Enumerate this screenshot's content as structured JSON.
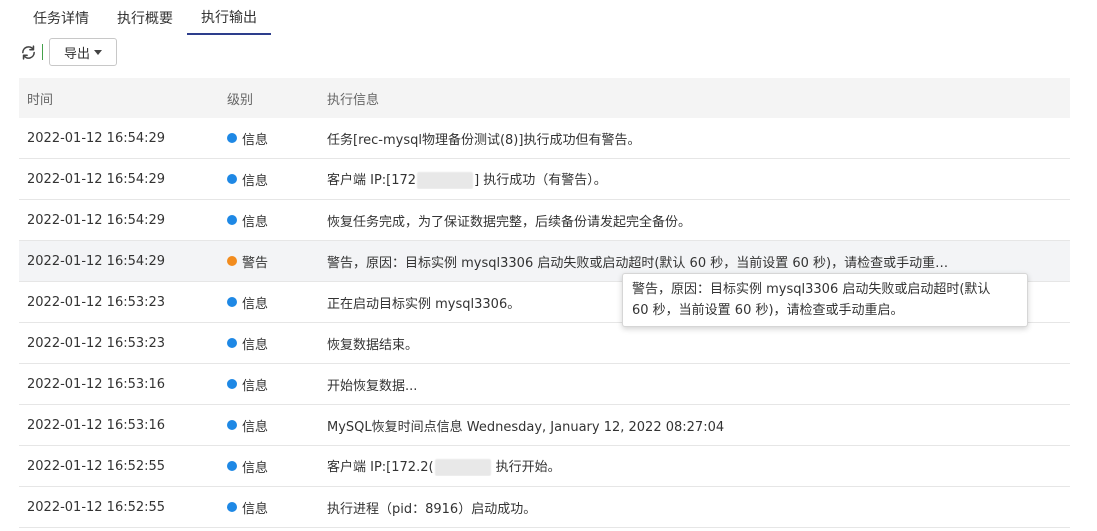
{
  "tabs": [
    {
      "label": "任务详情",
      "active": false
    },
    {
      "label": "执行概要",
      "active": false
    },
    {
      "label": "执行输出",
      "active": true
    }
  ],
  "toolbar": {
    "refresh_icon": "refresh-icon",
    "export_label": "导出"
  },
  "table": {
    "headers": {
      "time": "时间",
      "level": "级别",
      "message": "执行信息"
    },
    "rows": [
      {
        "time": "2022-01-12 16:54:29",
        "level": "信息",
        "type": "info",
        "message": "任务[rec-mysql物理备份测试(8)]执行成功但有警告。"
      },
      {
        "time": "2022-01-12 16:54:29",
        "level": "信息",
        "type": "info",
        "message_pre": "客户端 IP:[172",
        "message_post": "] 执行成功（有警告）。"
      },
      {
        "time": "2022-01-12 16:54:29",
        "level": "信息",
        "type": "info",
        "message": "恢复任务完成，为了保证数据完整，后续备份请发起完全备份。"
      },
      {
        "time": "2022-01-12 16:54:29",
        "level": "警告",
        "type": "warn",
        "message": "警告，原因：目标实例 mysql3306 启动失败或启动超时(默认 60 秒，当前设置 60 秒)，请检查或手动重…"
      },
      {
        "time": "2022-01-12 16:53:23",
        "level": "信息",
        "type": "info",
        "message": "正在启动目标实例 mysql3306。"
      },
      {
        "time": "2022-01-12 16:53:23",
        "level": "信息",
        "type": "info",
        "message": "恢复数据结束。"
      },
      {
        "time": "2022-01-12 16:53:16",
        "level": "信息",
        "type": "info",
        "message": "开始恢复数据..."
      },
      {
        "time": "2022-01-12 16:53:16",
        "level": "信息",
        "type": "info",
        "message": "MySQL恢复时间点信息 Wednesday, January 12, 2022 08:27:04"
      },
      {
        "time": "2022-01-12 16:52:55",
        "level": "信息",
        "type": "info",
        "message_pre": "客户端 IP:[172.2(",
        "message_post": " 执行开始。"
      },
      {
        "time": "2022-01-12 16:52:55",
        "level": "信息",
        "type": "info",
        "message": "执行进程（pid：8916）启动成功。"
      }
    ]
  },
  "tooltip": {
    "line1": "警告，原因：目标实例 mysql3306 启动失败或启动超时(默认",
    "line2": "60 秒，当前设置 60 秒)，请检查或手动重启。"
  },
  "colors": {
    "info": "#1e88e5",
    "warn": "#f28c1e",
    "tab_active": "#2d3e8c"
  }
}
